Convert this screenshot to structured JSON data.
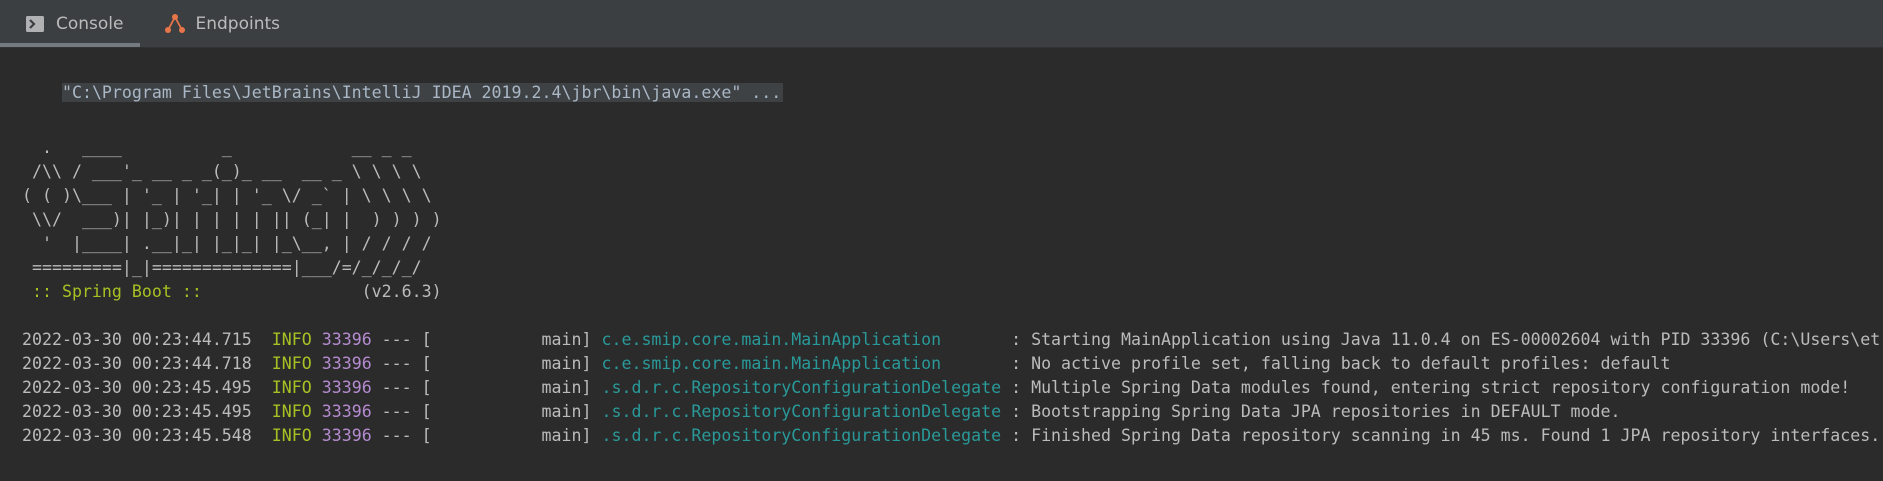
{
  "tabs": [
    {
      "label": "Console",
      "icon": "console-icon",
      "active": true
    },
    {
      "label": "Endpoints",
      "icon": "endpoints-icon",
      "active": false
    }
  ],
  "console": {
    "command": "\"C:\\Program Files\\JetBrains\\IntelliJ IDEA 2019.2.4\\jbr\\bin\\java.exe\" ...",
    "banner": [
      "  .   ____          _            __ _ _",
      " /\\\\ / ___'_ __ _ _(_)_ __  __ _ \\ \\ \\ \\",
      "( ( )\\___ | '_ | '_| | '_ \\/ _` | \\ \\ \\ \\",
      " \\\\/  ___)| |_)| | | | | || (_| |  ) ) ) )",
      "  '  |____| .__|_| |_|_| |_\\__, | / / / /",
      " =========|_|==============|___/=/_/_/_/"
    ],
    "spring_label": " :: Spring Boot :: ",
    "spring_version": "               (v2.6.3)",
    "logs": [
      {
        "ts": "2022-03-30 00:23:44.715",
        "level": "INFO",
        "pid": "33396",
        "sep": " --- [",
        "thread": "           main] ",
        "logger": "c.e.smip.core.main.MainApplication      ",
        "message": " : Starting MainApplication using Java 11.0.4 on ES-00002604 with PID 33396 (C:\\Users\\et"
      },
      {
        "ts": "2022-03-30 00:23:44.718",
        "level": "INFO",
        "pid": "33396",
        "sep": " --- [",
        "thread": "           main] ",
        "logger": "c.e.smip.core.main.MainApplication      ",
        "message": " : No active profile set, falling back to default profiles: default"
      },
      {
        "ts": "2022-03-30 00:23:45.495",
        "level": "INFO",
        "pid": "33396",
        "sep": " --- [",
        "thread": "           main] ",
        "logger": ".s.d.r.c.RepositoryConfigurationDelegate",
        "message": " : Multiple Spring Data modules found, entering strict repository configuration mode!"
      },
      {
        "ts": "2022-03-30 00:23:45.495",
        "level": "INFO",
        "pid": "33396",
        "sep": " --- [",
        "thread": "           main] ",
        "logger": ".s.d.r.c.RepositoryConfigurationDelegate",
        "message": " : Bootstrapping Spring Data JPA repositories in DEFAULT mode."
      },
      {
        "ts": "2022-03-30 00:23:45.548",
        "level": "INFO",
        "pid": "33396",
        "sep": " --- [",
        "thread": "           main] ",
        "logger": ".s.d.r.c.RepositoryConfigurationDelegate",
        "message": " : Finished Spring Data repository scanning in 45 ms. Found 1 JPA repository interfaces."
      }
    ]
  },
  "colors": {
    "background": "#2b2b2b",
    "tabbar": "#3c3f41",
    "info": "#a8c023",
    "pid": "#b58bd0",
    "logger": "#299999"
  }
}
